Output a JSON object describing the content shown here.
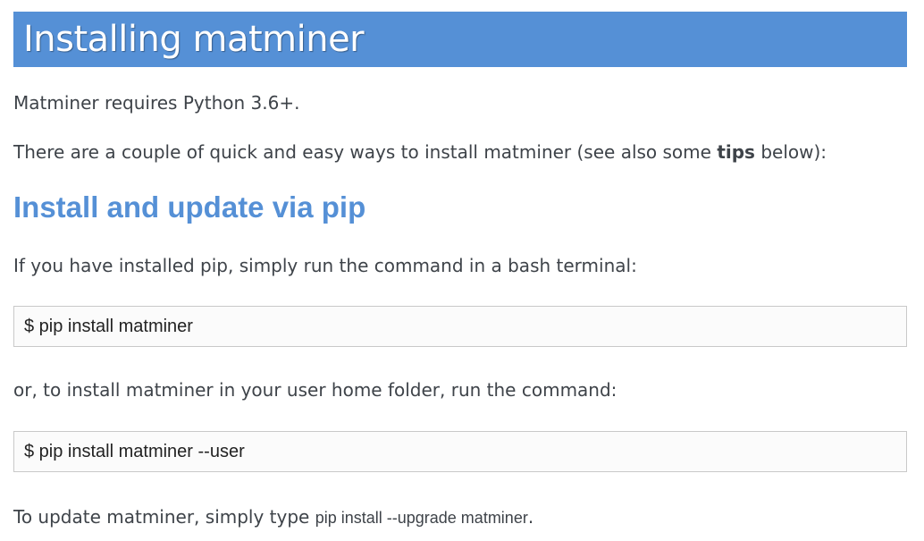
{
  "heading": "Installing matminer",
  "intro": {
    "requirement": "Matminer requires Python 3.6+.",
    "ways_prefix": "There are a couple of quick and easy ways to install matminer (see also some ",
    "ways_bold": "tips",
    "ways_suffix": " below):"
  },
  "pip_section": {
    "title": "Install and update via pip",
    "instruction": "If you have installed pip, simply run the command in a bash terminal:",
    "command_basic": "$ pip install matminer",
    "user_instruction": "or, to install matminer in your user home folder, run the command:",
    "command_user": "$ pip install matminer --user",
    "update_prefix": "To update matminer, simply type ",
    "update_code": "pip install --upgrade matminer",
    "update_suffix": "."
  },
  "colors": {
    "accent": "#5590d6",
    "text": "#3e4349",
    "code_border": "#c9c9c9"
  }
}
